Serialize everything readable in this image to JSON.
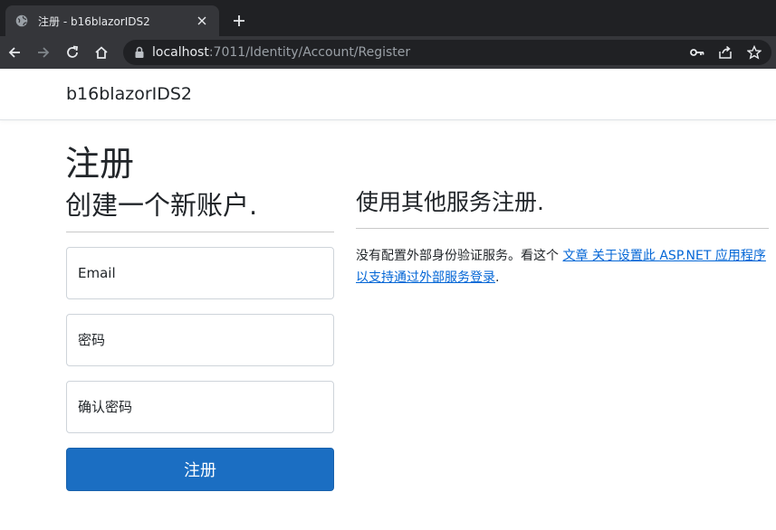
{
  "browser": {
    "tab_title": "注册 - b16blazorIDS2",
    "url_host": "localhost",
    "url_rest": ":7011/Identity/Account/Register"
  },
  "header": {
    "brand": "b16blazorIDS2"
  },
  "page": {
    "title": "注册"
  },
  "register_form": {
    "heading": "创建一个新账户.",
    "email_placeholder": "Email",
    "password_placeholder": "密码",
    "confirm_placeholder": "确认密码",
    "submit_label": "注册"
  },
  "external": {
    "heading": "使用其他服务注册.",
    "text_before": "没有配置外部身份验证服务。看这个 ",
    "link_text": "文章 关于设置此 ASP.NET 应用程序以支持通过外部服务登录",
    "text_after": "."
  }
}
